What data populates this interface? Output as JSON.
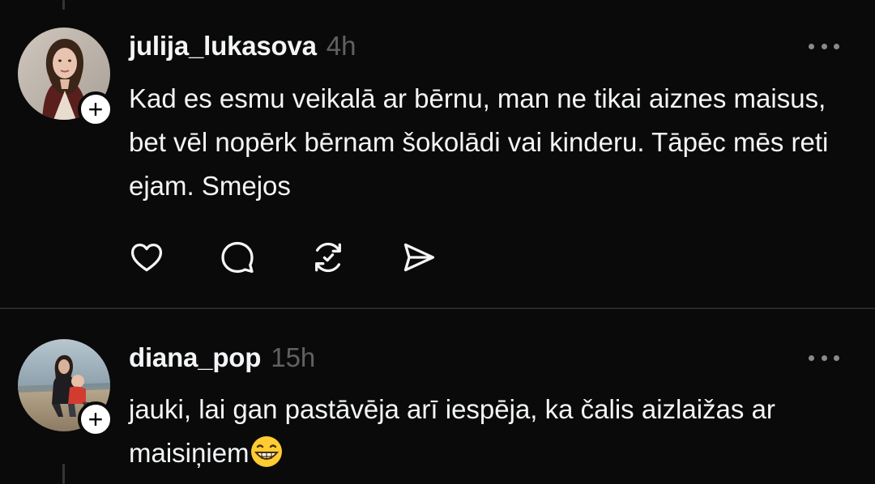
{
  "posts": [
    {
      "username": "julija_lukasova",
      "time": "4h",
      "text": "Kad es esmu veikalā ar bērnu, man ne tikai aiznes maisus, bet vēl nopērk bērnam šokolādi vai kinderu. Tāpēc mēs reti ejam. Smejos",
      "follow_symbol": "+",
      "actions": [
        "heart-icon",
        "comment-icon",
        "repost-icon",
        "share-icon"
      ]
    },
    {
      "username": "diana_pop",
      "time": "15h",
      "text": "jauki, lai gan pastāvēja arī iespēja, ka čalis aizlaižas ar maisiņiem",
      "emoji": "grinning-face-icon",
      "follow_symbol": "+"
    }
  ],
  "colors": {
    "background": "#0a0a0a",
    "text": "#f3f5f7",
    "muted": "#616161",
    "divider": "#26282a"
  }
}
